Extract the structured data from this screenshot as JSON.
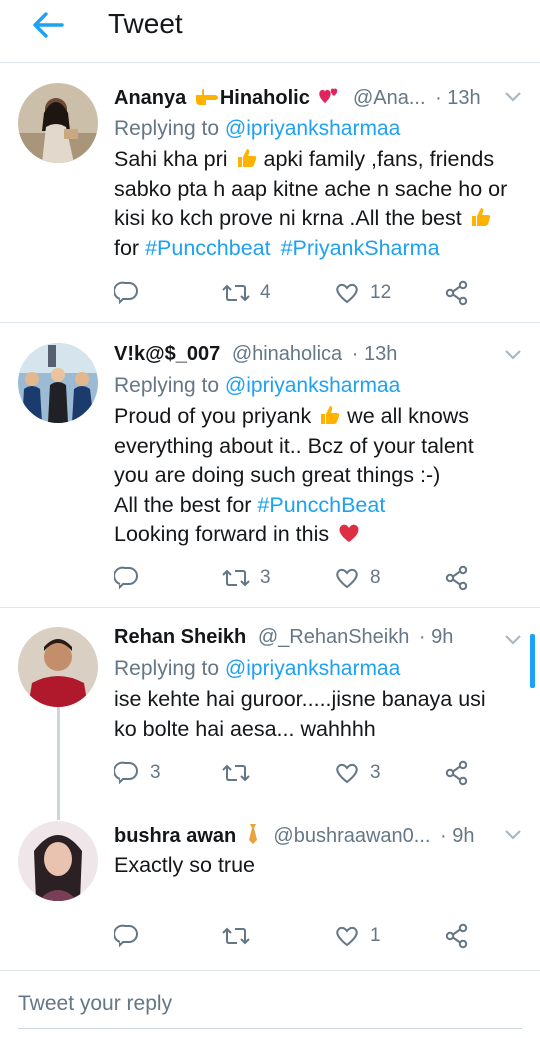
{
  "header": {
    "title": "Tweet"
  },
  "tweets": [
    {
      "name": "Ananya",
      "name2": "Hinaholic",
      "handle": "@Ana...",
      "time": "· 13h",
      "replying_prefix": "Replying to",
      "replying_to": "@ipriyanksharmaa",
      "lines": [
        "Sahi kha pri",
        "apki family ,fans, friends",
        "sabko pta h aap kitne ache n sache ho or",
        "kisi ko kch prove ni krna .All the best",
        "for"
      ],
      "tags": [
        "#Puncchbeat",
        "#PriyankSharma"
      ],
      "retweets": "4",
      "likes": "12"
    },
    {
      "name": "V!k@$_007",
      "handle": "@hinaholica",
      "time": "· 13h",
      "replying_prefix": "Replying to",
      "replying_to": "@ipriyanksharmaa",
      "lines": [
        "Proud of you priyank",
        "we all knows",
        "everything about it.. Bcz of your talent",
        "you are doing such great things :-)",
        "All the best for",
        "Looking forward in this"
      ],
      "tags": [
        "#PuncchBeat"
      ],
      "retweets": "3",
      "likes": "8"
    },
    {
      "name": "Rehan Sheikh",
      "handle": "@_RehanSheikh",
      "time": "· 9h",
      "replying_prefix": "Replying to",
      "replying_to": "@ipriyanksharmaa",
      "lines": [
        "ise kehte hai guroor.....jisne banaya usi",
        "ko bolte hai aesa... wahhhh"
      ],
      "replies": "3",
      "likes": "3"
    },
    {
      "name": "bushra awan",
      "handle": "@bushraawan0...",
      "time": "· 9h",
      "lines": [
        "Exactly so true"
      ],
      "likes": "1"
    }
  ],
  "reply_box": {
    "placeholder": "Tweet your reply"
  },
  "colors": {
    "accent": "#1da1f2",
    "secondary_text": "#657786",
    "divider": "#e1e8ed",
    "heart": "#e0245e"
  }
}
